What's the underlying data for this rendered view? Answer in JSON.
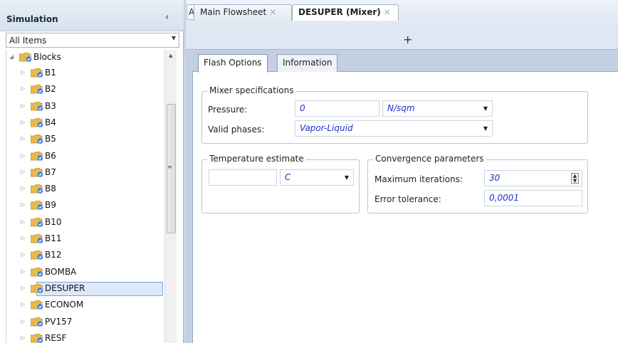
{
  "nav": {
    "title": "Simulation",
    "collapse_glyph": "‹",
    "filter_value": "All Items",
    "tree": {
      "root_label": "Blocks",
      "items": [
        "B1",
        "B2",
        "B3",
        "B4",
        "B5",
        "B6",
        "B7",
        "B8",
        "B9",
        "B10",
        "B11",
        "B12",
        "BOMBA",
        "DESUPER",
        "ECONOM",
        "PV157",
        "RESF"
      ],
      "selected": "DESUPER"
    }
  },
  "header": {
    "analysis_tab": "Analysis",
    "doc_tabs": [
      "Main Flowsheet",
      "DESUPER (Mixer)"
    ],
    "close_glyph": "×",
    "add_tab_glyph": "+"
  },
  "form": {
    "tabs": [
      "Flash Options",
      "Information"
    ],
    "mixer_specs": {
      "title": "Mixer specifications",
      "pressure_label": "Pressure:",
      "pressure_value": "0",
      "pressure_unit": "N/sqm",
      "phases_label": "Valid phases:",
      "phases_value": "Vapor-Liquid"
    },
    "temp_estimate": {
      "title": "Temperature estimate",
      "value": "",
      "unit": "C"
    },
    "convergence": {
      "title": "Convergence parameters",
      "max_iter_label": "Maximum iterations:",
      "max_iter_value": "30",
      "tol_label": "Error tolerance:",
      "tol_value": "0,0001"
    }
  },
  "colors": {
    "value_text": "#1d2fd0",
    "folder": "#e7b94f",
    "check": "#3b7ddb"
  },
  "icons": {
    "folder": "folder-check-icon",
    "expand": "triangle-right-icon",
    "collapse": "triangle-down-icon"
  }
}
